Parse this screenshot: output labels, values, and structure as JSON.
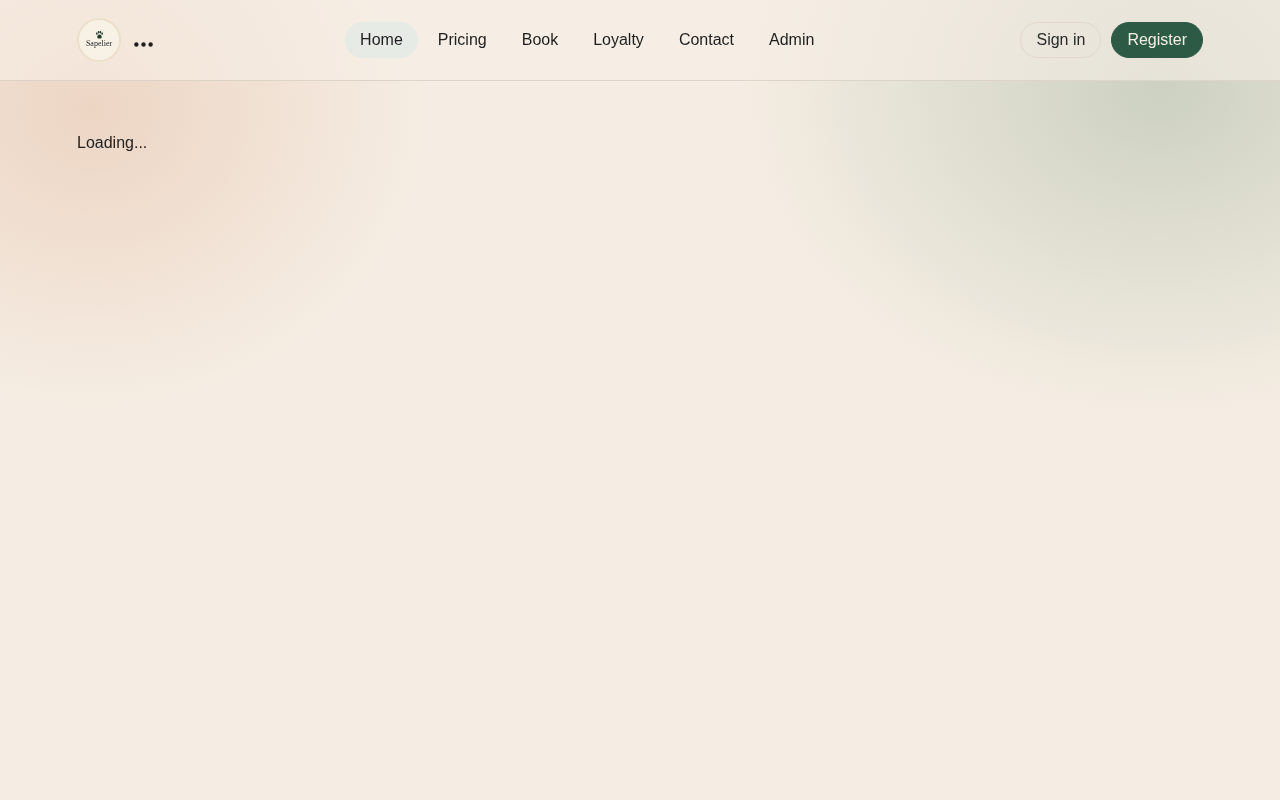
{
  "header": {
    "logo": {
      "text": "Sapelier"
    },
    "nav": [
      {
        "label": "Home",
        "selected": true
      },
      {
        "label": "Pricing",
        "selected": false
      },
      {
        "label": "Book",
        "selected": false
      },
      {
        "label": "Loyalty",
        "selected": false
      },
      {
        "label": "Contact",
        "selected": false
      },
      {
        "label": "Admin",
        "selected": false
      }
    ],
    "actions": [
      {
        "label": "Sign in",
        "kind": "outline"
      },
      {
        "label": "Register",
        "kind": "primary"
      }
    ]
  },
  "main": {
    "status": "Loading..."
  }
}
